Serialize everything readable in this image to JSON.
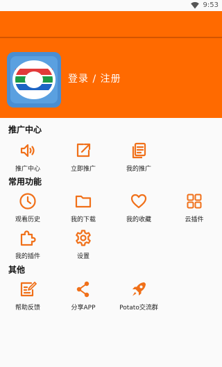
{
  "status_bar": {
    "time": "9:53",
    "wifi_icon": "wifi-icon"
  },
  "header": {
    "login_text": "登录 / 注册",
    "logo_icon": "tvb-logo-icon",
    "accent_color": "#ff6a00"
  },
  "sections": [
    {
      "title": "推广中心",
      "items": [
        {
          "label": "推广中心",
          "icon": "speaker-icon"
        },
        {
          "label": "立即推广",
          "icon": "share-out-icon"
        },
        {
          "label": "我的推广",
          "icon": "document-list-icon"
        }
      ]
    },
    {
      "title": "常用功能",
      "items": [
        {
          "label": "观看历史",
          "icon": "clock-icon"
        },
        {
          "label": "我的下载",
          "icon": "folder-icon"
        },
        {
          "label": "我的收藏",
          "icon": "heart-icon"
        },
        {
          "label": "云插件",
          "icon": "grid-icon"
        },
        {
          "label": "我的插件",
          "icon": "puzzle-icon"
        },
        {
          "label": "设置",
          "icon": "gear-icon"
        }
      ]
    },
    {
      "title": "其他",
      "items": [
        {
          "label": "帮助反馈",
          "icon": "feedback-edit-icon"
        },
        {
          "label": "分享APP",
          "icon": "share-nodes-icon"
        },
        {
          "label": "Potato交流群",
          "icon": "rocket-icon"
        }
      ]
    }
  ]
}
